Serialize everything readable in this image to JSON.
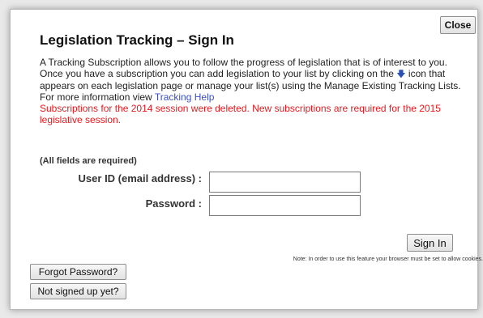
{
  "dialog": {
    "close_label": "Close",
    "title": "Legislation Tracking – Sign In",
    "intro": {
      "part1": "A Tracking Subscription allows you to follow the progress of legislation that is of interest to you. Once you have a subscription you can add legislation to your list by clicking on the ",
      "part2": " icon that appears on each legislation page or manage your list(s) using the Manage Existing Tracking Lists. For more information view ",
      "help_link": "Tracking Help",
      "warning": "Subscriptions for the 2014 session were deleted. New subscriptions are required for the 2015 legislative session."
    },
    "required_note": "(All fields are required)",
    "userid_label": "User ID (email address) :",
    "userid_value": "",
    "password_label": "Password :",
    "password_value": "",
    "signin_label": "Sign In",
    "cookie_note": "Note: In order to use this feature your browser must be set to allow cookies.",
    "forgot_label": "Forgot Password?",
    "signup_label": "Not signed up yet?"
  },
  "icons": {
    "track_icon": "blue-down-arrow-icon"
  },
  "colors": {
    "link": "#3a4fc1",
    "warning": "#e8181d"
  }
}
